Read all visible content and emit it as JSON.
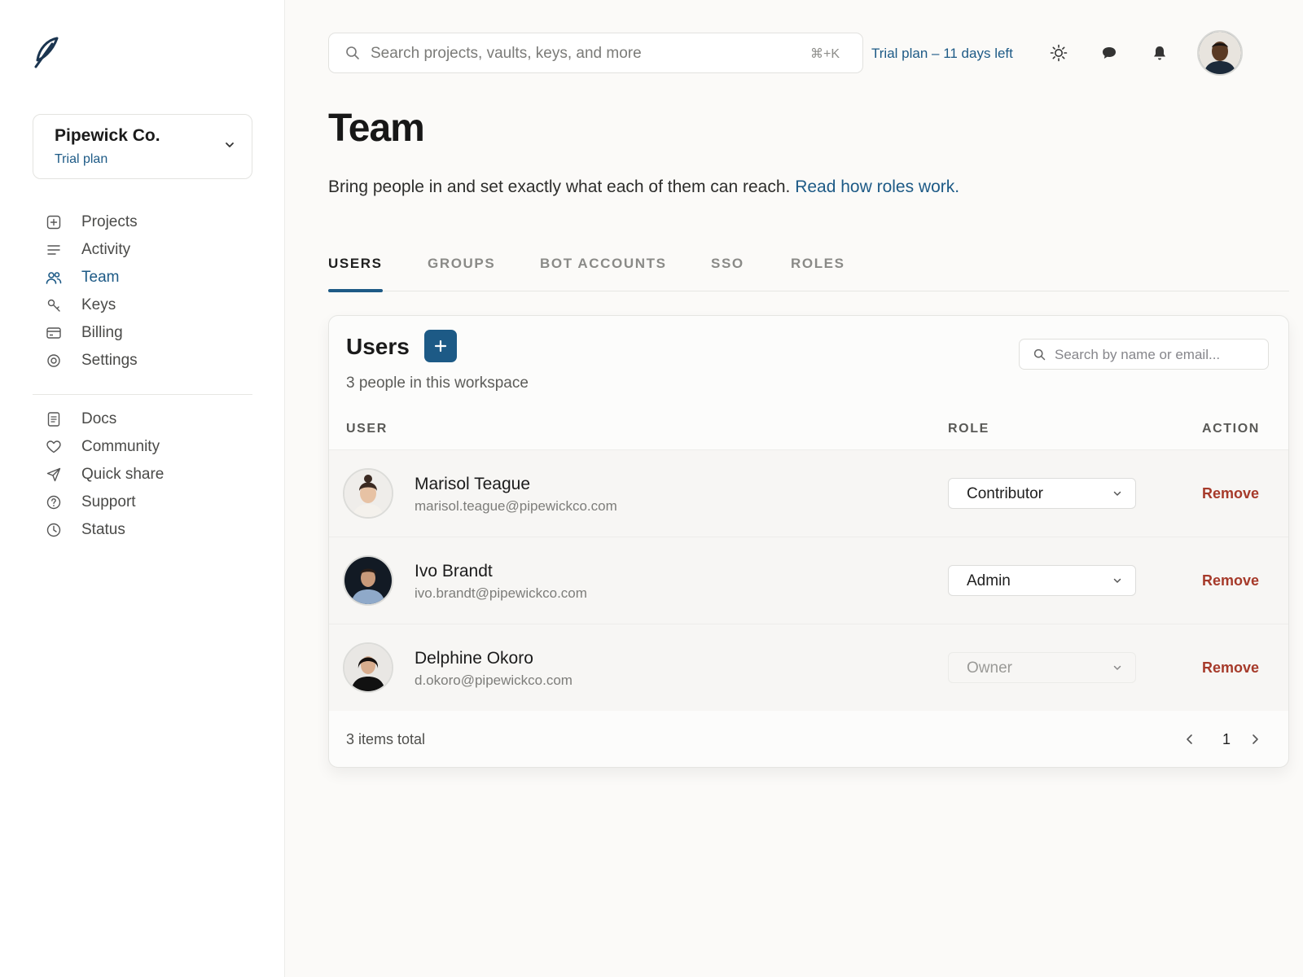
{
  "org": {
    "name": "Pipewick Co.",
    "plan": "Trial plan"
  },
  "nav": {
    "primary": [
      {
        "label": "Projects",
        "icon": "plus-square-icon"
      },
      {
        "label": "Activity",
        "icon": "lines-icon"
      },
      {
        "label": "Team",
        "icon": "users-icon",
        "active": true
      },
      {
        "label": "Keys",
        "icon": "key-icon"
      },
      {
        "label": "Billing",
        "icon": "credit-card-icon"
      },
      {
        "label": "Settings",
        "icon": "target-icon"
      }
    ],
    "secondary": [
      {
        "label": "Docs",
        "icon": "document-icon"
      },
      {
        "label": "Community",
        "icon": "heart-icon"
      },
      {
        "label": "Quick share",
        "icon": "send-icon"
      },
      {
        "label": "Support",
        "icon": "help-circle-icon"
      },
      {
        "label": "Status",
        "icon": "clock-icon"
      }
    ]
  },
  "topbar": {
    "search_placeholder": "Search projects, vaults, keys, and more",
    "shortcut": "⌘+K",
    "trial_text": "Trial plan – 11 days left"
  },
  "page": {
    "title": "Team",
    "description": "Bring people in and set exactly what each of them can reach.",
    "description_link": "Read how roles work."
  },
  "tabs": [
    {
      "label": "USERS",
      "active": true
    },
    {
      "label": "GROUPS"
    },
    {
      "label": "BOT ACCOUNTS"
    },
    {
      "label": "SSO"
    },
    {
      "label": "ROLES"
    }
  ],
  "users_card": {
    "title": "Users",
    "subtitle": "3 people in this workspace",
    "search_placeholder": "Search by name or email...",
    "columns": {
      "user": "USER",
      "role": "ROLE",
      "action": "ACTION"
    },
    "rows": [
      {
        "name": "Marisol Teague",
        "email": "marisol.teague@pipewickco.com",
        "role": "Contributor",
        "role_disabled": false,
        "action": "Remove"
      },
      {
        "name": "Ivo Brandt",
        "email": "ivo.brandt@pipewickco.com",
        "role": "Admin",
        "role_disabled": false,
        "action": "Remove"
      },
      {
        "name": "Delphine Okoro",
        "email": "d.okoro@pipewickco.com",
        "role": "Owner",
        "role_disabled": true,
        "action": "Remove"
      }
    ],
    "footer_text": "3 items total",
    "current_page": "1"
  },
  "colors": {
    "accent": "#1d5a86",
    "danger": "#a63a2a"
  }
}
